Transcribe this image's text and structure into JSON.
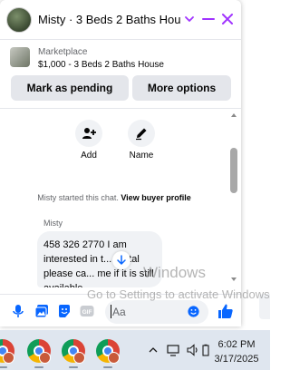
{
  "header": {
    "title": "Misty · 3 Beds 2 Baths Hou..."
  },
  "listing": {
    "source": "Marketplace",
    "summary": "$1,000 - 3 Beds 2 Baths House"
  },
  "actions": {
    "mark_pending": "Mark as pending",
    "more_options": "More options",
    "add_label": "Add",
    "name_label": "Name"
  },
  "thread": {
    "started_text": "Misty started this chat.",
    "view_profile": "View buyer profile",
    "sender": "Misty",
    "message": "458 326 2770  I am interested in t... rental please ca... me if it is still available"
  },
  "composer": {
    "placeholder": "Aa"
  },
  "watermark": {
    "line1": "Windows",
    "line2": "Go to Settings to activate Windows"
  },
  "taskbar": {
    "time": "6:02 PM",
    "date": "3/17/2025"
  },
  "colors": {
    "accent": "#a033ff",
    "messenger_blue": "#0866ff"
  }
}
